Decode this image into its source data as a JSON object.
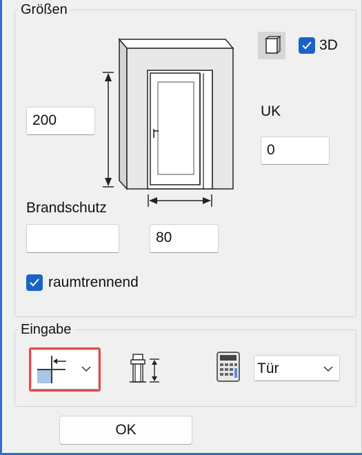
{
  "groessen": {
    "title": "Größen",
    "height_value": "200",
    "uk_label": "UK",
    "uk_value": "0",
    "width_value": "80",
    "brandschutz_label": "Brandschutz",
    "brandschutz_value": "",
    "checkbox_3d_label": "3D",
    "checkbox_3d_checked": true,
    "raumtrennend_label": "raumtrennend",
    "raumtrennend_checked": true,
    "icons": [
      "door-preview-icon",
      "3d-view-toggle-icon"
    ]
  },
  "eingabe": {
    "title": "Eingabe",
    "type_select_value": "Tür",
    "icons": [
      "insertion-mode-icon",
      "chevron-down-icon",
      "opening-section-icon",
      "calculator-icon"
    ]
  },
  "ok_label": "OK",
  "highlight_color": "#e5484d",
  "accent_color": "#1a63c6"
}
